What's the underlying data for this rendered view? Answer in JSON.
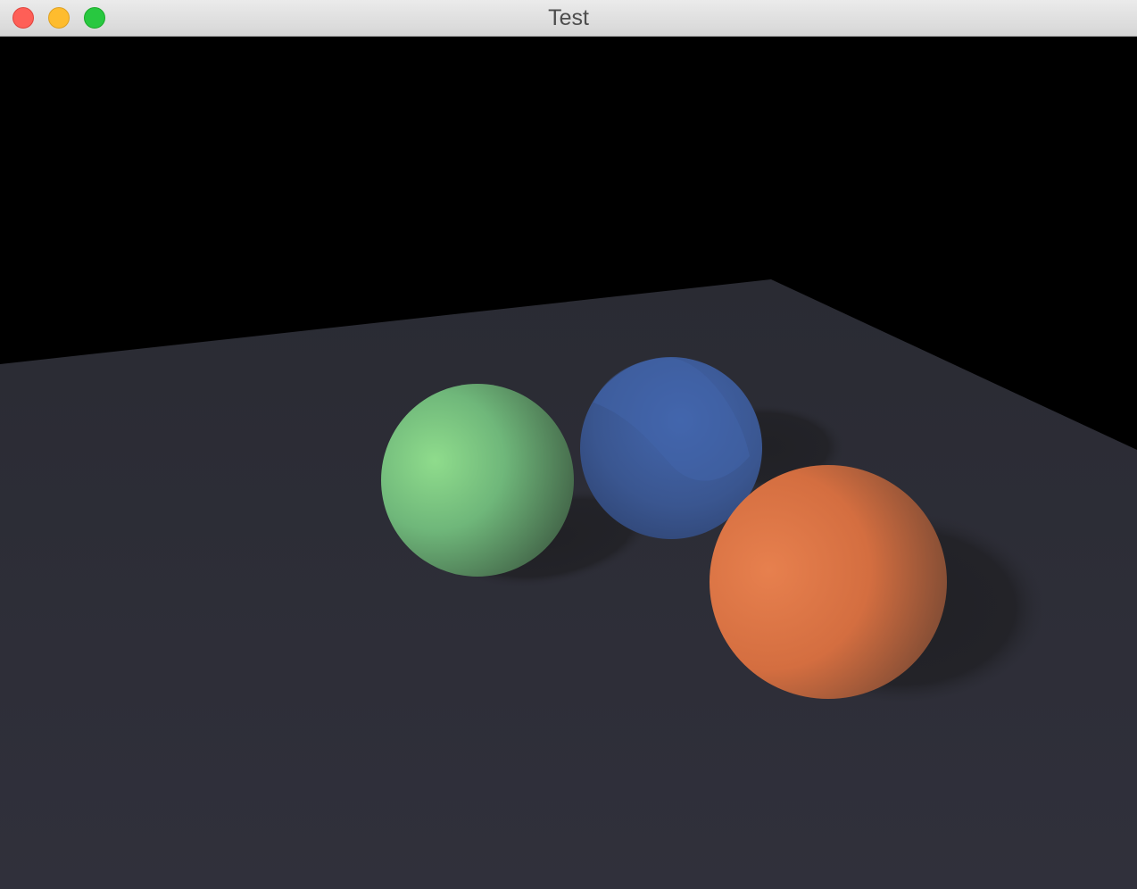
{
  "window": {
    "title": "Test"
  },
  "scene": {
    "background_color": "#000000",
    "plane_color": "#2c2d36",
    "shadow_color": "#222227",
    "spheres": [
      {
        "name": "green-sphere",
        "color": "#6fb77a",
        "highlight": "#8fdc8c",
        "dark": "#3f5e44"
      },
      {
        "name": "blue-sphere",
        "color": "#3a5690",
        "highlight": "#4366ad",
        "dark": "#2b3e68"
      },
      {
        "name": "orange-sphere",
        "color": "#d46e40",
        "highlight": "#e7804e",
        "dark": "#6f4532"
      }
    ]
  }
}
